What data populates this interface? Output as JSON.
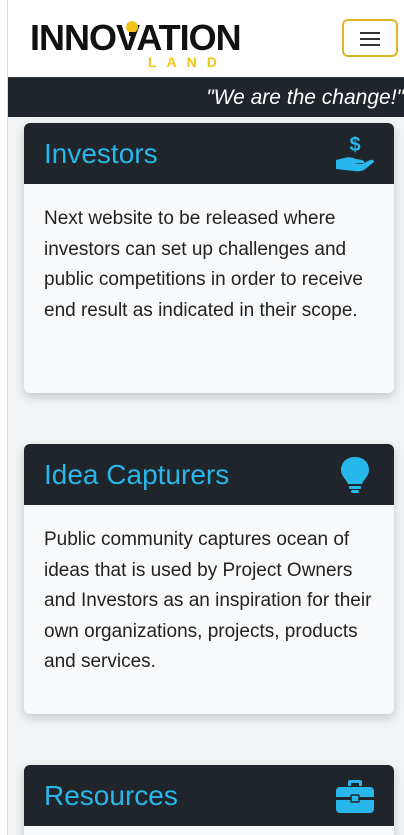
{
  "brand": {
    "logo_word": "INNOVATION",
    "logo_sub": "LAND",
    "colors": {
      "accent": "#27b7ea",
      "gold": "#f0c419",
      "dark": "#1f252b"
    }
  },
  "navbar": {
    "toggler_icon": "hamburger-icon"
  },
  "slogan": "\"We are the change!\"",
  "cards": [
    {
      "title": "Investors",
      "icon": "hand-dollar-icon",
      "text": "Next website to be released where investors can set up challenges and public competitions in order to receive end result as indicated in their scope."
    },
    {
      "title": "Idea Capturers",
      "icon": "lightbulb-icon",
      "text": "Public community captures ocean of ideas that is used by Project Owners and Investors as an inspiration for their own organizations, projects, products and services."
    },
    {
      "title": "Resources",
      "icon": "toolbox-icon",
      "text": ""
    }
  ]
}
